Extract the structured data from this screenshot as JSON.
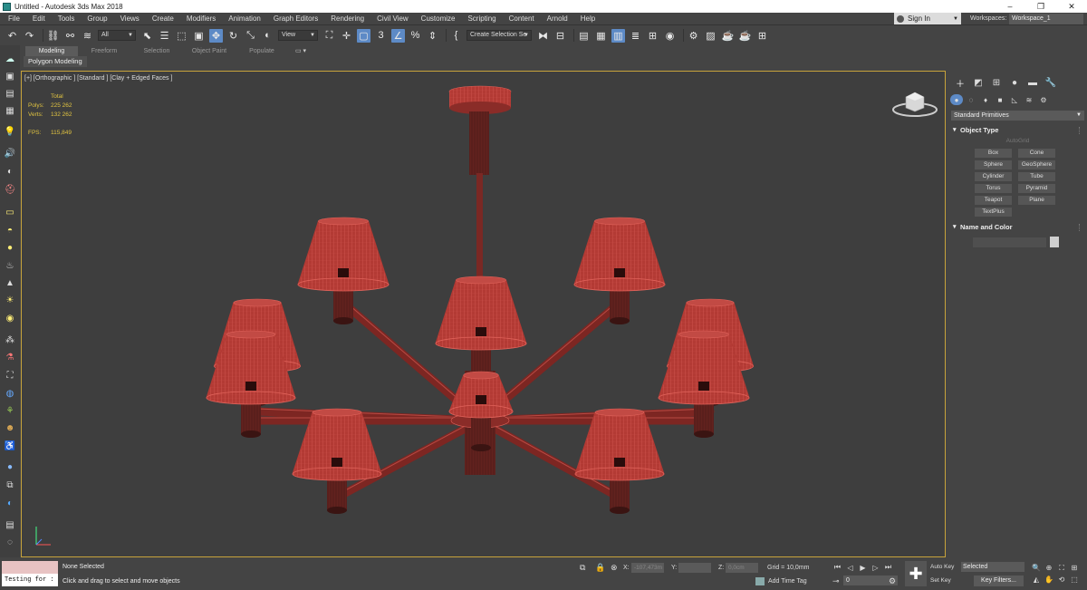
{
  "window": {
    "title": "Untitled - Autodesk 3ds Max 2018",
    "controls": {
      "minimize": "–",
      "maximize": "❐",
      "close": "✕"
    }
  },
  "menu": {
    "items": [
      "File",
      "Edit",
      "Tools",
      "Group",
      "Views",
      "Create",
      "Modifiers",
      "Animation",
      "Graph Editors",
      "Rendering",
      "Civil View",
      "Customize",
      "Scripting",
      "Content",
      "Arnold",
      "Help"
    ],
    "signin": "Sign In",
    "workspaces_label": "Workspaces:",
    "workspace_value": "Workspace_1"
  },
  "toolbar": {
    "selection_filter": "All",
    "ref_coord": "View",
    "selection_set": "Create Selection Se",
    "snap_label": "3"
  },
  "ribbon": {
    "tabs": [
      "Modeling",
      "Freeform",
      "Selection",
      "Object Paint",
      "Populate"
    ],
    "active_tab": "Modeling",
    "sub_panel": "Polygon Modeling"
  },
  "viewport": {
    "label": "[+] [Orthographic ] [Standard ] [Clay + Edged Faces ]",
    "stats": {
      "total_label": "Total",
      "polys_label": "Polys:",
      "polys_value": "225 262",
      "verts_label": "Verts:",
      "verts_value": "132 262",
      "fps_label": "FPS:",
      "fps_value": "115,849"
    },
    "lamp_color": "#b33a34",
    "wire_color": "#e0625a",
    "border_color": "#c7a33b"
  },
  "command_panel": {
    "category": "Standard Primitives",
    "object_type_title": "Object Type",
    "autogrid": "AutoGrid",
    "primitives": [
      "Box",
      "Cone",
      "Sphere",
      "GeoSphere",
      "Cylinder",
      "Tube",
      "Torus",
      "Pyramid",
      "Teapot",
      "Plane",
      "TextPlus"
    ],
    "name_color_title": "Name and Color"
  },
  "status": {
    "script_input": "Testing for :",
    "selection": "None Selected",
    "prompt": "Click and drag to select and move objects",
    "x_label": "X:",
    "x_value": "-107,473m",
    "y_label": "Y:",
    "y_value": "",
    "z_label": "Z:",
    "z_value": "0,0cm",
    "grid": "Grid = 10,0mm",
    "add_time_tag": "Add Time Tag",
    "frame": "0",
    "auto_key": "Auto Key",
    "set_key": "Set Key",
    "key_mode": "Selected",
    "key_filters": "Key Filters..."
  }
}
